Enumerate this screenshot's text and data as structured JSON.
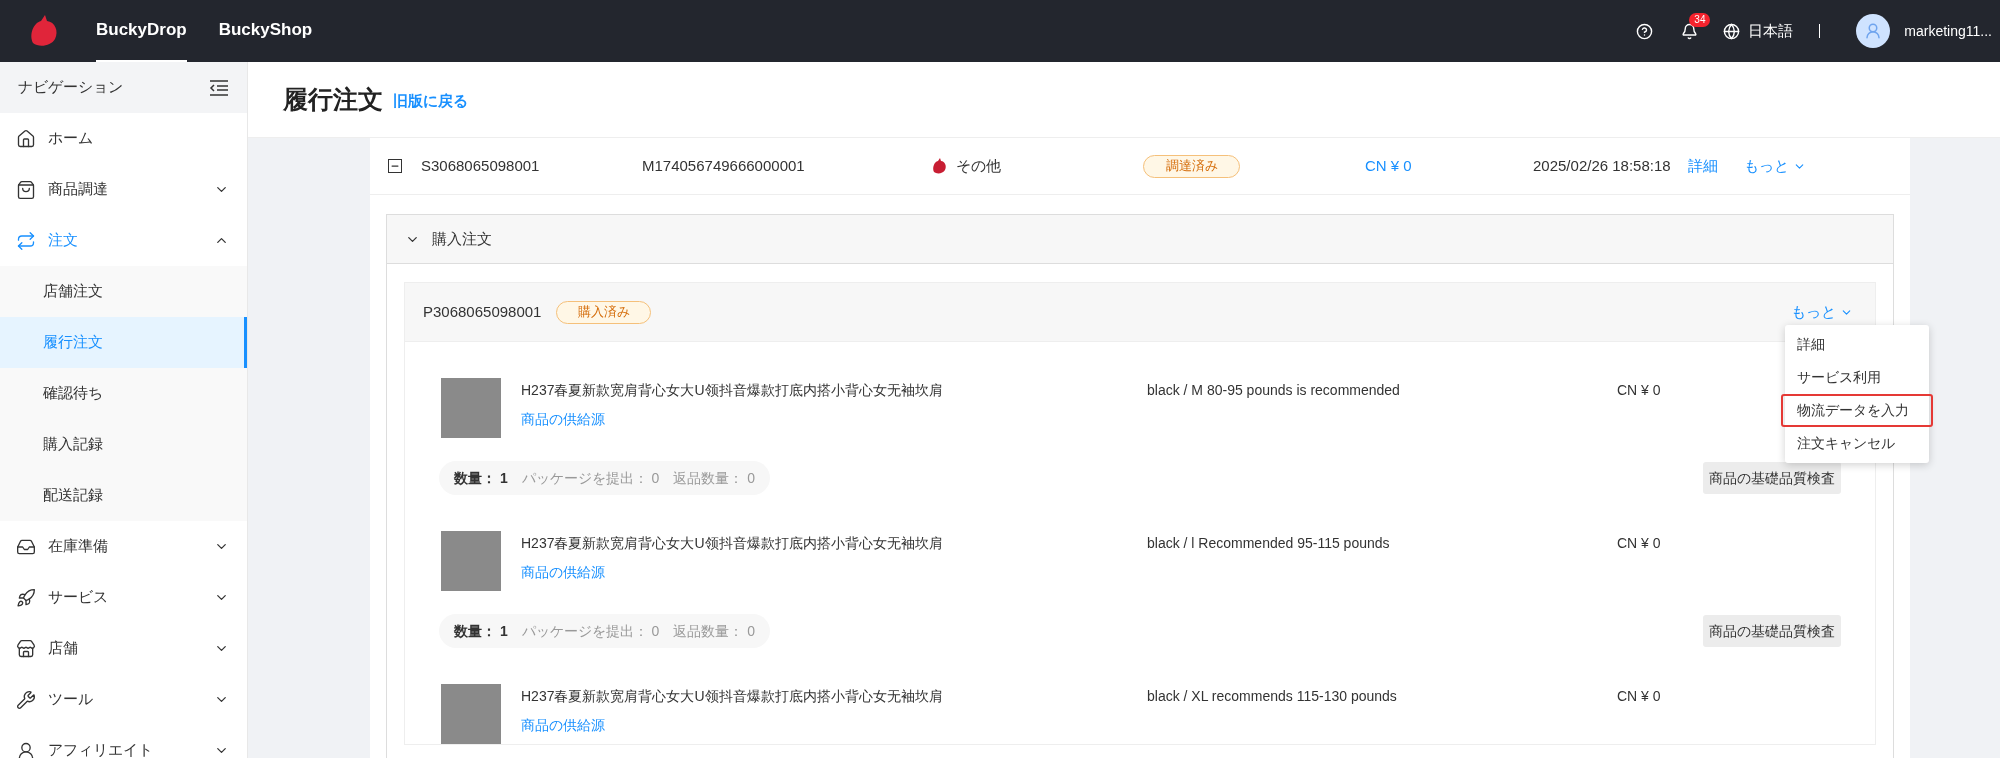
{
  "top_nav": {
    "tabs": [
      {
        "label": "BuckyDrop",
        "selected": true
      },
      {
        "label": "BuckyShop",
        "selected": false
      }
    ],
    "notification_count": "34",
    "language": "日本語",
    "user": "marketing11..."
  },
  "sidebar": {
    "title": "ナビゲーション",
    "items": [
      {
        "label": "ホーム",
        "selected": false
      },
      {
        "label": "商品調達",
        "selected": false,
        "expanded": false
      },
      {
        "label": "注文",
        "selected": true,
        "expanded": true,
        "children": [
          {
            "label": "店舗注文",
            "selected": false
          },
          {
            "label": "履行注文",
            "selected": true
          },
          {
            "label": "確認待ち",
            "selected": false
          },
          {
            "label": "購入記録",
            "selected": false
          },
          {
            "label": "配送記録",
            "selected": false
          }
        ]
      },
      {
        "label": "在庫準備",
        "selected": false,
        "expanded": false
      },
      {
        "label": "サービス",
        "selected": false,
        "expanded": false
      },
      {
        "label": "店舗",
        "selected": false,
        "expanded": false
      },
      {
        "label": "ツール",
        "selected": false,
        "expanded": false
      },
      {
        "label": "アフィリエイト",
        "selected": false,
        "expanded": false
      }
    ]
  },
  "page": {
    "title": "履行注文",
    "back_link": "旧版に戻る"
  },
  "order": {
    "expanded": true,
    "order_no": "S3068065098001",
    "m_no": "M174056749666000001",
    "source": "その他",
    "status": "調達済み",
    "amount": "CN ¥ 0",
    "date": "2025/02/26 18:58:18",
    "detail": "詳細",
    "more": "もっと"
  },
  "purchase_section": {
    "title": "購入注文",
    "expanded": true,
    "purchase_order": {
      "number": "P3068065098001",
      "status": "購入済み",
      "more": "もっと",
      "menu": [
        {
          "label": "詳細",
          "highlighted": false
        },
        {
          "label": "サービス利用",
          "highlighted": false
        },
        {
          "label": "物流データを入力",
          "highlighted": true
        },
        {
          "label": "注文キャンセル",
          "highlighted": false
        }
      ],
      "items": [
        {
          "title": "H237春夏新款宽肩背心女大U领抖音爆款打底内搭小背心女无袖坎肩",
          "source_link": "商品の供給源",
          "variant": "black / M 80-95 pounds is recommended",
          "price": "CN ¥ 0",
          "quantity_label": "数量：",
          "quantity": "1",
          "package_label": "パッケージを提出：",
          "package": "0",
          "return_label": "返品数量：",
          "return": "0",
          "inspection": "商品の基礎品質検査"
        },
        {
          "title": "H237春夏新款宽肩背心女大U领抖音爆款打底内搭小背心女无袖坎肩",
          "source_link": "商品の供給源",
          "variant": "black / l Recommended 95-115 pounds",
          "price": "CN ¥ 0",
          "quantity_label": "数量：",
          "quantity": "1",
          "package_label": "パッケージを提出：",
          "package": "0",
          "return_label": "返品数量：",
          "return": "0",
          "inspection": "商品の基礎品質検査"
        },
        {
          "title": "H237春夏新款宽肩背心女大U领抖音爆款打底内搭小背心女无袖坎肩",
          "source_link": "商品の供給源",
          "variant": "black / XL recommends 115-130 pounds",
          "price": "CN ¥ 0"
        }
      ]
    }
  }
}
